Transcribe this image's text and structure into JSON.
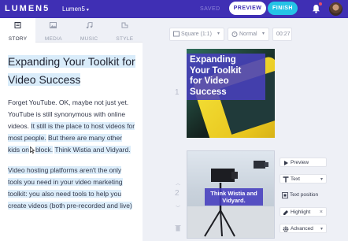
{
  "topbar": {
    "logo": "LUMEN5",
    "project": "Lumen5",
    "project_caret": "▾",
    "saved": "SAVED",
    "preview": "PREVIEW",
    "finish": "FINISH",
    "bg_color": "#3f2fb4",
    "finish_color": "#25c3e6"
  },
  "tabs": [
    {
      "label": "STORY",
      "icon": "story-icon"
    },
    {
      "label": "MEDIA",
      "icon": "media-icon"
    },
    {
      "label": "MUSIC",
      "icon": "music-icon"
    },
    {
      "label": "STYLE",
      "icon": "style-icon"
    }
  ],
  "story": {
    "title_line1": "Expanding Your Toolkit for",
    "title_line2": "Video Success",
    "p1_a": "Forget YouTube.  OK, maybe not just yet.  YouTube is still synonymous with online videos. ",
    "p1_b": "It still is the place to host videos for most people.",
    "p1_c": " ",
    "p1_d": "But there are many other kids on",
    "p1_e": "block.",
    "p1_f": " ",
    "p1_g": "Think Wistia and Vidyard.",
    "p2": "Video hosting platforms aren't the only tools you need in your video marketing toolkit: you also need tools to help you create videos (both pre-recorded and live)"
  },
  "workspace": {
    "format": "Square (1:1)",
    "speed": "Normal",
    "duration": "00:27",
    "scene1_number": "1",
    "scene2_number": "2",
    "scene1_caption_l1": "Expanding",
    "scene1_caption_l2": "Your Toolkit",
    "scene1_caption_l3": "for Video",
    "scene1_caption_l4": "Success",
    "scene2_caption": "Think Wistia and Vidyard.",
    "caret": "▾",
    "up_arrow": "︿",
    "down_arrow": "﹀"
  },
  "side_menu": {
    "preview": "Preview",
    "text": "Text",
    "text_position": "Text position",
    "highlight": "Highlight",
    "advanced": "Advanced",
    "close": "×"
  }
}
